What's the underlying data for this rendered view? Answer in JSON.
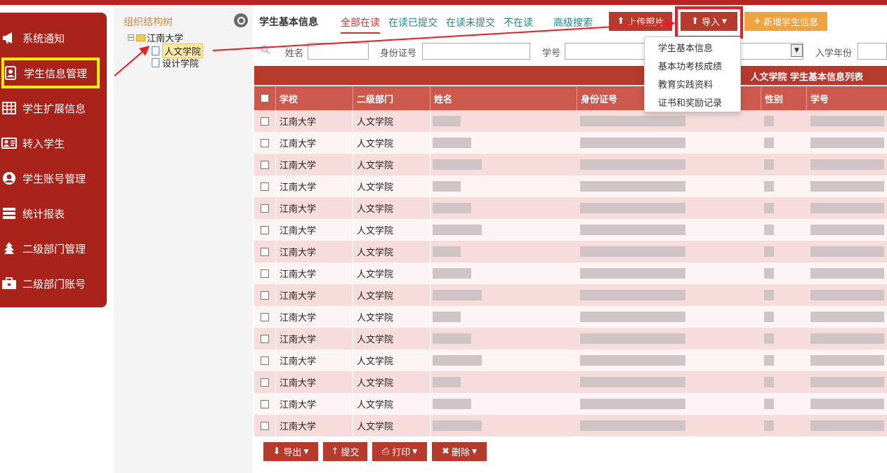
{
  "sidebar": {
    "items": [
      {
        "label": "系统通知",
        "icon": "megaphone-icon"
      },
      {
        "label": "学生信息管理",
        "icon": "address-book-icon"
      },
      {
        "label": "学生扩展信息",
        "icon": "table-icon"
      },
      {
        "label": "转入学生",
        "icon": "id-card-icon"
      },
      {
        "label": "学生账号管理",
        "icon": "user-circle-icon"
      },
      {
        "label": "统计报表",
        "icon": "list-icon"
      },
      {
        "label": "二级部门管理",
        "icon": "tree-icon"
      },
      {
        "label": "二级部门账号",
        "icon": "briefcase-icon"
      }
    ]
  },
  "tree": {
    "title": "组织结构树",
    "root": "江南大学",
    "children": [
      "人文学院",
      "设计学院"
    ]
  },
  "toolbar": {
    "title": "学生基本信息",
    "tabs": [
      "全部在读",
      "在读已提交",
      "在读未提交",
      "不在读"
    ],
    "advanced_search": "高级搜索",
    "upload_photo": "上传照片",
    "import": "导入",
    "add_student": "新增学生信息"
  },
  "import_menu": [
    "学生基本信息",
    "基本功考核成绩",
    "教育实践资料",
    "证书和奖励记录"
  ],
  "filter": {
    "name_label": "姓名",
    "id_label": "身份证号",
    "student_no_label": "学号",
    "year_label": "入学年份"
  },
  "list_title": "人文学院 学生基本信息列表",
  "table": {
    "headers": [
      "学校",
      "二级部门",
      "姓名",
      "身份证号",
      "性别",
      "学号"
    ],
    "rows": [
      {
        "school": "江南大学",
        "dept": "人文学院"
      },
      {
        "school": "江南大学",
        "dept": "人文学院"
      },
      {
        "school": "江南大学",
        "dept": "人文学院"
      },
      {
        "school": "江南大学",
        "dept": "人文学院"
      },
      {
        "school": "江南大学",
        "dept": "人文学院"
      },
      {
        "school": "江南大学",
        "dept": "人文学院"
      },
      {
        "school": "江南大学",
        "dept": "人文学院"
      },
      {
        "school": "江南大学",
        "dept": "人文学院"
      },
      {
        "school": "江南大学",
        "dept": "人文学院"
      },
      {
        "school": "江南大学",
        "dept": "人文学院"
      },
      {
        "school": "江南大学",
        "dept": "人文学院"
      },
      {
        "school": "江南大学",
        "dept": "人文学院"
      },
      {
        "school": "江南大学",
        "dept": "人文学院"
      },
      {
        "school": "江南大学",
        "dept": "人文学院"
      },
      {
        "school": "江南大学",
        "dept": "人文学院"
      }
    ]
  },
  "bottom": {
    "export": "导出",
    "submit": "提交",
    "print": "打印",
    "delete": "删除"
  },
  "colors": {
    "sidebar_bg": "#a9231a",
    "highlight_yellow": "#f4f000",
    "annotation_red": "#ea1c24",
    "header_red": "#cd594c",
    "tab_teal": "#1d8a8a"
  }
}
